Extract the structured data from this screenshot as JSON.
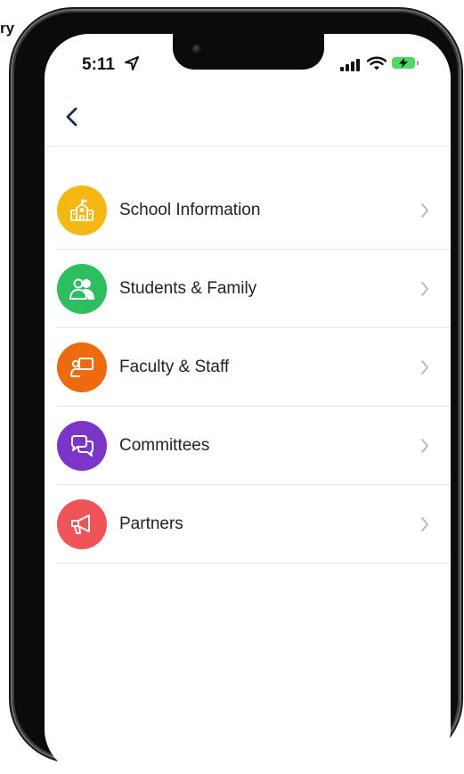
{
  "status_bar": {
    "time": "5:11"
  },
  "header": {
    "back_icon": "chevron-left-icon"
  },
  "menu": {
    "items": [
      {
        "label": "School Information",
        "icon": "school-icon",
        "color": "#F5B813"
      },
      {
        "label": "Students & Family",
        "icon": "people-icon",
        "color": "#2DBE60"
      },
      {
        "label": "Faculty & Staff",
        "icon": "presenter-icon",
        "color": "#EE6A0E"
      },
      {
        "label": "Committees",
        "icon": "chat-bubbles-icon",
        "color": "#7C35C9"
      },
      {
        "label": "Partners",
        "icon": "megaphone-icon",
        "color": "#EF5558"
      }
    ]
  },
  "colors": {
    "accent_dark": "#1C2B4A"
  }
}
